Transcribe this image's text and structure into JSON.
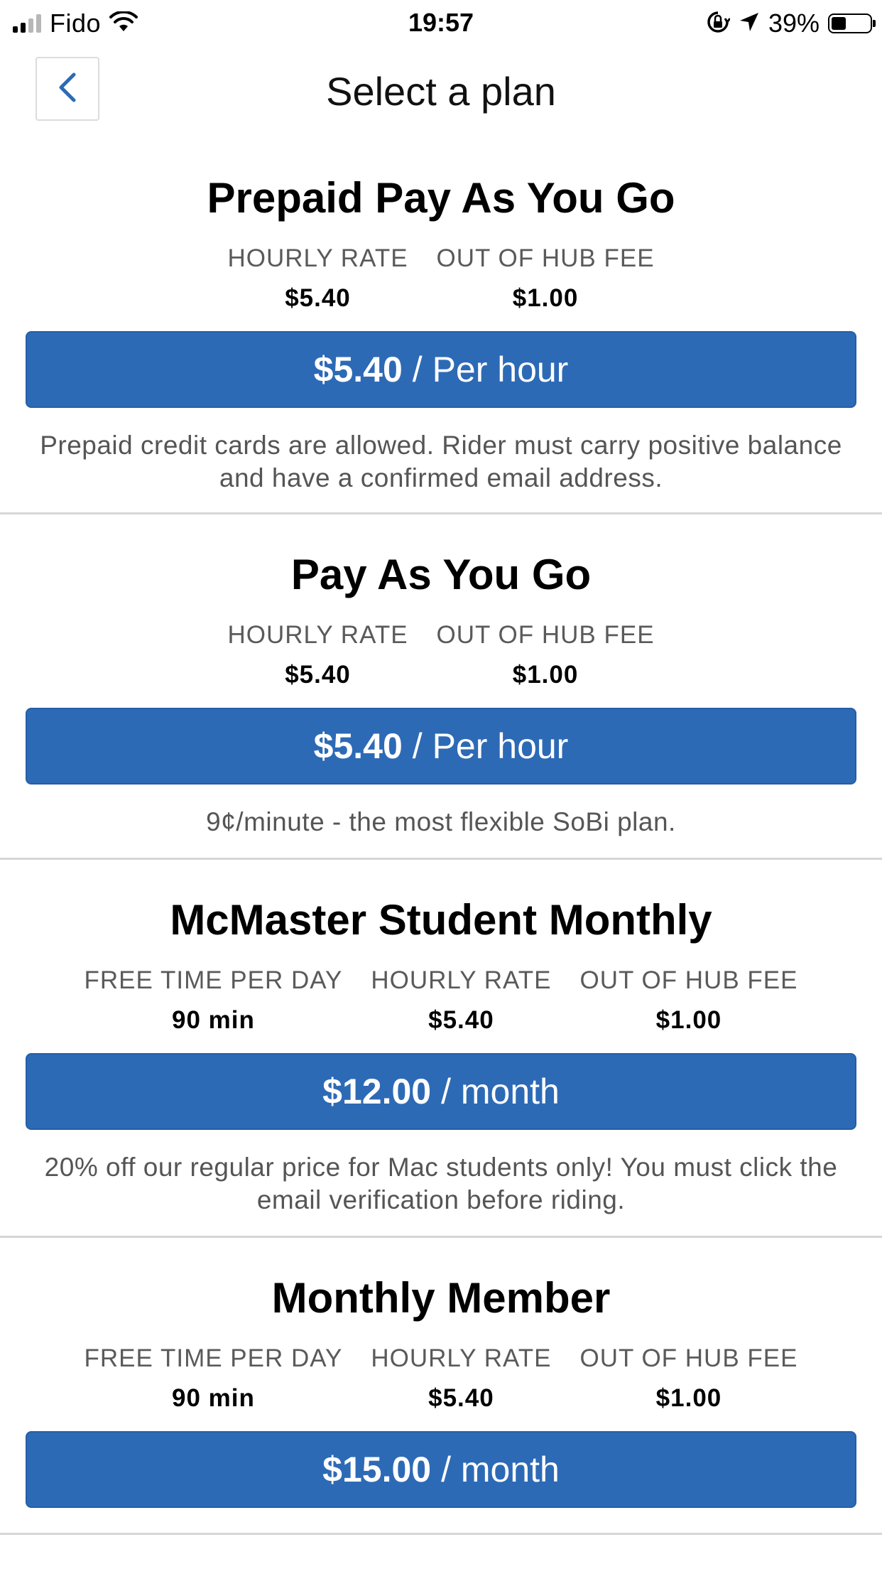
{
  "status_bar": {
    "carrier": "Fido",
    "time": "19:57",
    "battery_percent": "39%",
    "battery_level": 0.39,
    "icons": [
      "signal-icon",
      "wifi-icon",
      "orientation-lock-icon",
      "location-arrow-icon",
      "battery-icon"
    ]
  },
  "header": {
    "back_icon": "chevron-left-icon",
    "title": "Select a plan"
  },
  "plans": [
    {
      "title": "Prepaid Pay As You Go",
      "stats": [
        {
          "label": "HOURLY RATE",
          "value": "$5.40"
        },
        {
          "label": "OUT OF HUB FEE",
          "value": "$1.00"
        }
      ],
      "price": "$5.40",
      "period": "/ Per hour",
      "description": "Prepaid credit cards are allowed. Rider must carry positive balance and have a confirmed email address."
    },
    {
      "title": "Pay As You Go",
      "stats": [
        {
          "label": "HOURLY RATE",
          "value": "$5.40"
        },
        {
          "label": "OUT OF HUB FEE",
          "value": "$1.00"
        }
      ],
      "price": "$5.40",
      "period": "/ Per hour",
      "description": "9¢/minute - the most flexible SoBi plan."
    },
    {
      "title": "McMaster Student Monthly",
      "stats": [
        {
          "label": "FREE TIME PER DAY",
          "value": "90 min"
        },
        {
          "label": "HOURLY RATE",
          "value": "$5.40"
        },
        {
          "label": "OUT OF HUB FEE",
          "value": "$1.00"
        }
      ],
      "price": "$12.00",
      "period": "/ month",
      "description": "20% off our regular price for Mac students only! You must click the email verification before riding."
    },
    {
      "title": "Monthly Member",
      "stats": [
        {
          "label": "FREE TIME PER DAY",
          "value": "90 min"
        },
        {
          "label": "HOURLY RATE",
          "value": "$5.40"
        },
        {
          "label": "OUT OF HUB FEE",
          "value": "$1.00"
        }
      ],
      "price": "$15.00",
      "period": "/ month",
      "description": ""
    }
  ],
  "colors": {
    "button_bg": "#2d6ab6",
    "back_chevron": "#2d6ab6",
    "divider": "#d6d6d6",
    "label_gray": "#5a5a5a"
  }
}
